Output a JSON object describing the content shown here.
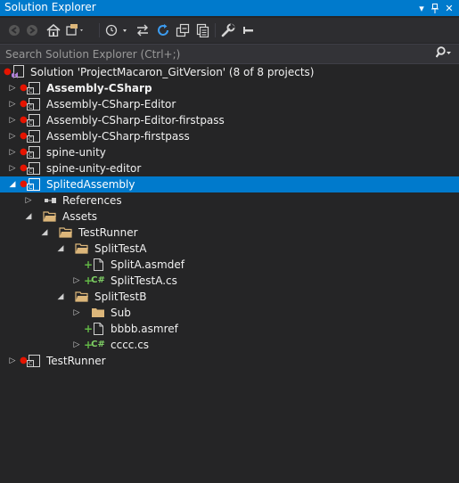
{
  "window": {
    "title": "Solution Explorer"
  },
  "search": {
    "placeholder": "Search Solution Explorer (Ctrl+;)"
  },
  "toolbar": {
    "buttons": [
      "back",
      "forward",
      "home",
      "switch-views",
      "pending-changes-filter",
      "sync-with-active-document",
      "refresh",
      "collapse-all",
      "show-all-files",
      "properties",
      "preview"
    ]
  },
  "tree": {
    "solution": "Solution 'ProjectMacaron_GitVersion' (8 of 8 projects)",
    "p1": "Assembly-CSharp",
    "p2": "Assembly-CSharp-Editor",
    "p3": "Assembly-CSharp-Editor-firstpass",
    "p4": "Assembly-CSharp-firstpass",
    "p5": "spine-unity",
    "p6": "spine-unity-editor",
    "p7": "SplitedAssembly",
    "references": "References",
    "assets": "Assets",
    "testrunner_folder": "TestRunner",
    "splittesta": "SplitTestA",
    "splita_asmdef": "SplitA.asmdef",
    "splittesta_cs": "SplitTestA.cs",
    "splittestb": "SplitTestB",
    "sub": "Sub",
    "bbbb_asmref": "bbbb.asmref",
    "cccc_cs": "cccc.cs",
    "p8": "TestRunner"
  },
  "colors": {
    "accent": "#007acc",
    "background": "#252526",
    "folder": "#dcb67a",
    "git_modified": "#e51400",
    "git_added": "#63b846"
  }
}
